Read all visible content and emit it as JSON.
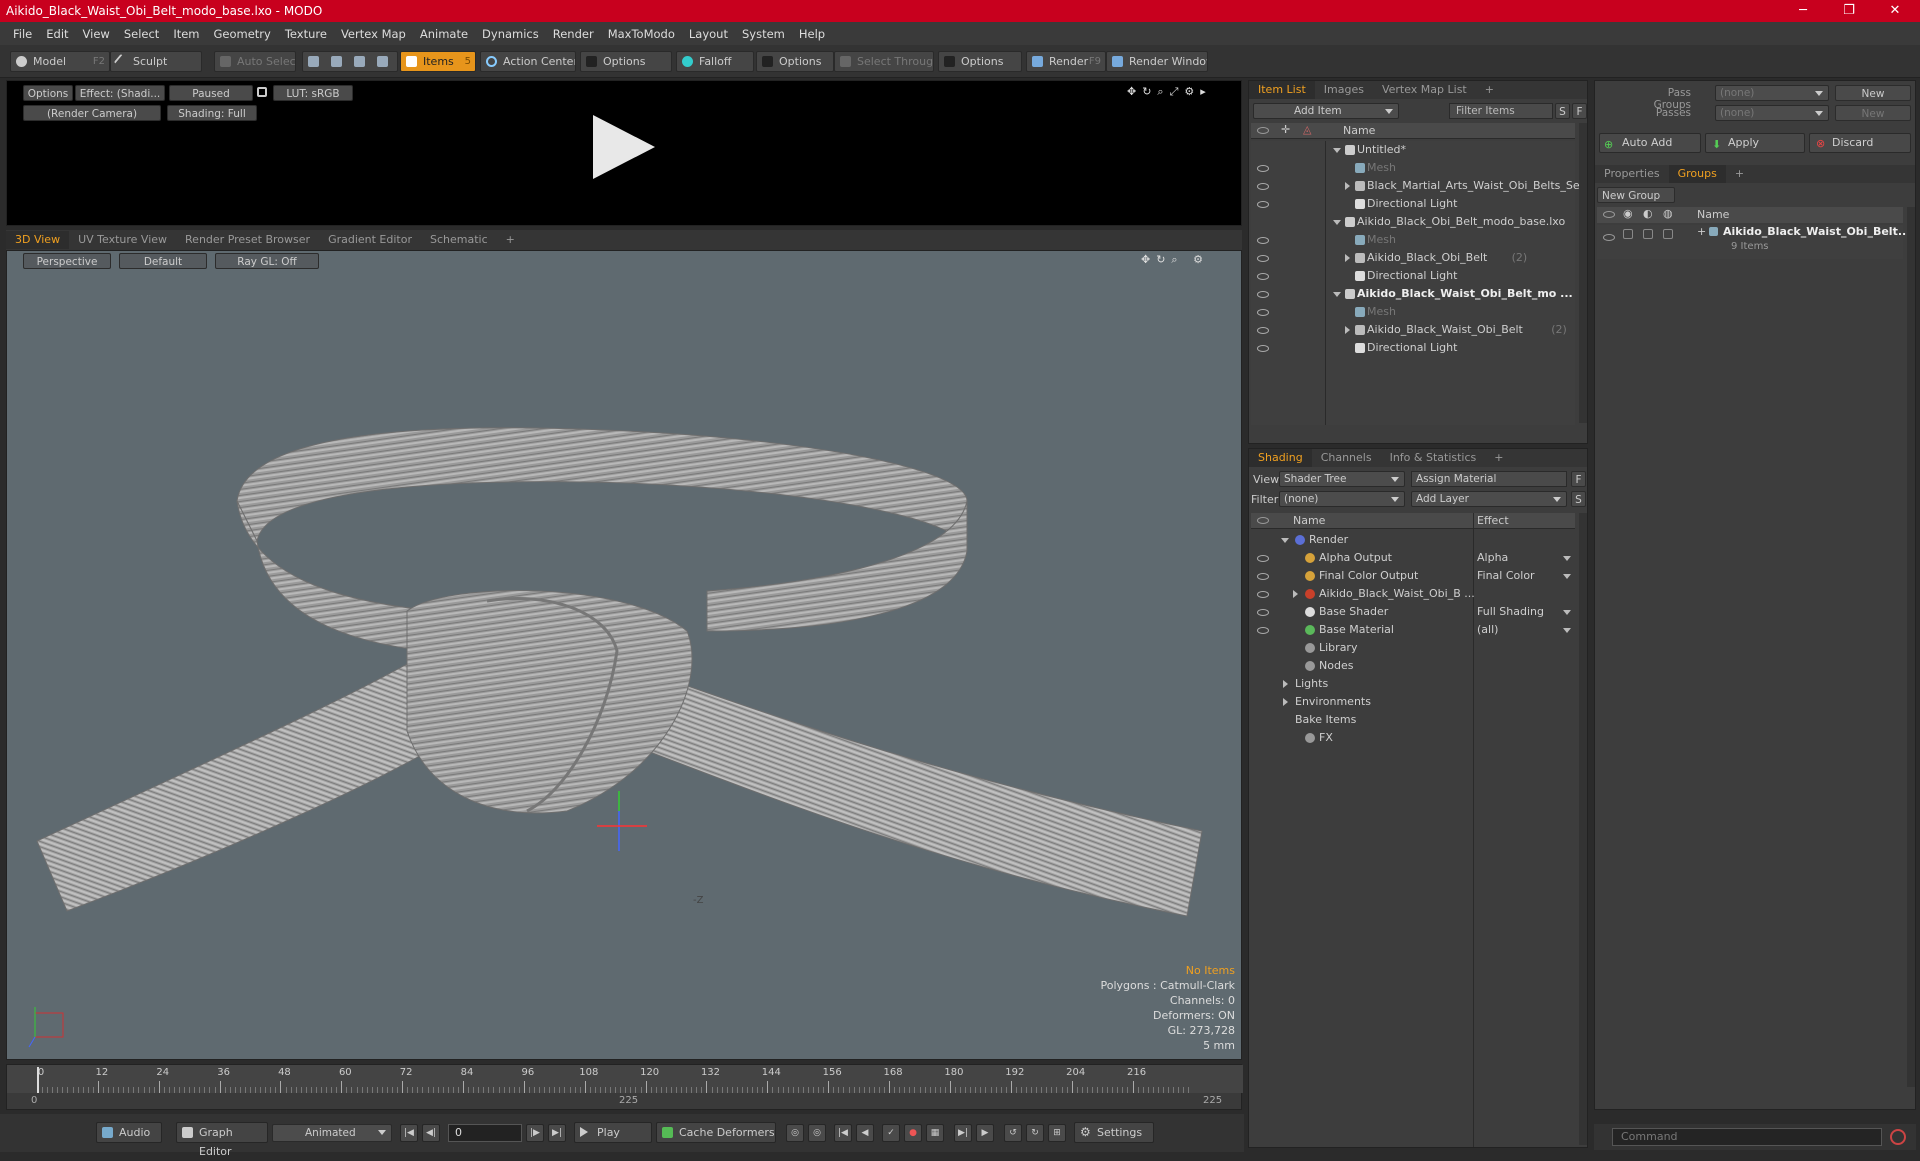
{
  "window": {
    "title": "Aikido_Black_Waist_Obi_Belt_modo_base.lxo - MODO",
    "minimize": "─",
    "maximize": "❐",
    "close": "✕"
  },
  "menu": [
    "File",
    "Edit",
    "View",
    "Select",
    "Item",
    "Geometry",
    "Texture",
    "Vertex Map",
    "Animate",
    "Dynamics",
    "Render",
    "MaxToModo",
    "Layout",
    "System",
    "Help"
  ],
  "toolbar": {
    "model": "Model",
    "model_key": "F2",
    "sculpt": "Sculpt",
    "auto_select": "Auto Select",
    "items": "Items",
    "items_key": "5",
    "action_center": "Action Center",
    "options1": "Options",
    "falloff": "Falloff",
    "options2": "Options",
    "select_through": "Select Through",
    "options3": "Options",
    "render": "Render",
    "render_key": "F9",
    "render_window": "Render Window"
  },
  "preview": {
    "options": "Options",
    "effect": "Effect: (Shadi...",
    "paused": "Paused",
    "lut": "LUT: sRGB",
    "camera": "(Render Camera)",
    "shading": "Shading: Full"
  },
  "viewport_tabs": [
    "3D View",
    "UV Texture View",
    "Render Preset Browser",
    "Gradient Editor",
    "Schematic",
    "+"
  ],
  "viewport": {
    "perspective": "Perspective",
    "default": "Default",
    "raygl": "Ray GL: Off",
    "axis_label": "-Z",
    "hud": {
      "no_items": "No Items",
      "polygons": "Polygons : Catmull-Clark",
      "channels": "Channels: 0",
      "deformers": "Deformers: ON",
      "gl": "GL: 273,728",
      "scale": "5 mm"
    },
    "accent": "#f0a020"
  },
  "timeline": {
    "ticks": [
      "0",
      "12",
      "24",
      "36",
      "48",
      "60",
      "72",
      "84",
      "96",
      "108",
      "120",
      "132",
      "144",
      "156",
      "168",
      "180",
      "192",
      "204",
      "216"
    ],
    "start": "0",
    "mid": "225",
    "end": "225"
  },
  "bottom": {
    "audio": "Audio",
    "graph_editor": "Graph Editor",
    "animated": "Animated",
    "frame": "0",
    "play": "Play",
    "cache": "Cache Deformers",
    "settings": "Settings"
  },
  "item_list": {
    "tabs": [
      "Item List",
      "Images",
      "Vertex Map List",
      "+"
    ],
    "add_item": "Add Item",
    "filter": "Filter Items",
    "s": "S",
    "f": "F",
    "col_name": "Name",
    "rows": [
      {
        "label": "Untitled*",
        "indent": 0,
        "exp": "down",
        "type": "scene",
        "eye": false
      },
      {
        "label": "Mesh",
        "indent": 1,
        "exp": "",
        "type": "mesh",
        "eye": true,
        "dim": true
      },
      {
        "label": "Black_Martial_Arts_Waist_Obi_Belts_Set",
        "indent": 1,
        "exp": "right",
        "type": "group",
        "eye": true
      },
      {
        "label": "Directional Light",
        "indent": 1,
        "exp": "",
        "type": "light",
        "eye": true
      },
      {
        "label": "Aikido_Black_Obi_Belt_modo_base.lxo",
        "indent": 0,
        "exp": "down",
        "type": "scene",
        "eye": false
      },
      {
        "label": "Mesh",
        "indent": 1,
        "exp": "",
        "type": "mesh",
        "eye": true,
        "dim": true
      },
      {
        "label": "Aikido_Black_Obi_Belt",
        "suffix": "(2)",
        "indent": 1,
        "exp": "right",
        "type": "group",
        "eye": true
      },
      {
        "label": "Directional Light",
        "indent": 1,
        "exp": "",
        "type": "light",
        "eye": true
      },
      {
        "label": "Aikido_Black_Waist_Obi_Belt_mo ...",
        "indent": 0,
        "exp": "down",
        "type": "scene",
        "eye": true,
        "bold": true
      },
      {
        "label": "Mesh",
        "indent": 1,
        "exp": "",
        "type": "mesh",
        "eye": true,
        "dim": true
      },
      {
        "label": "Aikido_Black_Waist_Obi_Belt",
        "suffix": "(2)",
        "indent": 1,
        "exp": "right",
        "type": "group",
        "eye": true
      },
      {
        "label": "Directional Light",
        "indent": 1,
        "exp": "",
        "type": "light",
        "eye": true
      }
    ]
  },
  "shading": {
    "tabs": [
      "Shading",
      "Channels",
      "Info & Statistics",
      "+"
    ],
    "view_label": "View",
    "view_value": "Shader Tree",
    "assign": "Assign Material",
    "f": "F",
    "filter_label": "Filter",
    "filter_value": "(none)",
    "add_layer": "Add Layer",
    "s": "S",
    "col_name": "Name",
    "col_effect": "Effect",
    "rows": [
      {
        "label": "Render",
        "indent": 0,
        "exp": "down",
        "icon": "#5b6fd6",
        "effect": "",
        "eye": false
      },
      {
        "label": "Alpha Output",
        "indent": 1,
        "exp": "",
        "icon": "#d6a23a",
        "effect": "Alpha",
        "eye": true
      },
      {
        "label": "Final Color Output",
        "indent": 1,
        "exp": "",
        "icon": "#d6a23a",
        "effect": "Final Color",
        "eye": true
      },
      {
        "label": "Aikido_Black_Waist_Obi_B ...",
        "indent": 1,
        "exp": "right",
        "icon": "#c8402a",
        "effect": "",
        "eye": true
      },
      {
        "label": "Base Shader",
        "indent": 1,
        "exp": "",
        "icon": "#dddddd",
        "effect": "Full Shading",
        "eye": true
      },
      {
        "label": "Base Material",
        "indent": 1,
        "exp": "",
        "icon": "#5ab85a",
        "effect": "(all)",
        "eye": true
      },
      {
        "label": "Library",
        "indent": 1,
        "exp": "",
        "icon": "#999999",
        "effect": "",
        "eye": false
      },
      {
        "label": "Nodes",
        "indent": 1,
        "exp": "",
        "icon": "#999999",
        "effect": "",
        "eye": false
      },
      {
        "label": "Lights",
        "indent": 0,
        "exp": "right",
        "icon": "",
        "effect": "",
        "eye": false
      },
      {
        "label": "Environments",
        "indent": 0,
        "exp": "right",
        "icon": "",
        "effect": "",
        "eye": false
      },
      {
        "label": "Bake Items",
        "indent": 0,
        "exp": "",
        "icon": "",
        "effect": "",
        "eye": false
      },
      {
        "label": "FX",
        "indent": 1,
        "exp": "",
        "icon": "#999999",
        "effect": "",
        "eye": false
      }
    ]
  },
  "groups": {
    "pass_groups_label": "Pass Groups",
    "pass_groups_value": "(none)",
    "passes_label": "Passes",
    "passes_value": "(none)",
    "new1": "New",
    "new2": "New",
    "auto_add": "Auto Add",
    "apply": "Apply",
    "discard": "Discard",
    "tabs": [
      "Properties",
      "Groups",
      "+"
    ],
    "new_group": "New Group",
    "col_name": "Name",
    "group_name": "Aikido_Black_Waist_Obi_Belt...",
    "group_count": "9 Items"
  },
  "command": {
    "placeholder": "Command"
  }
}
